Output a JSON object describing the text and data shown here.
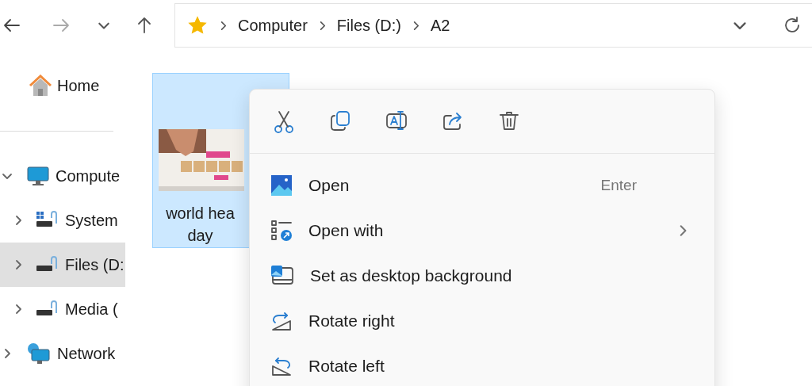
{
  "address_bar": {
    "crumbs": [
      "Computer",
      "Files (D:)",
      "A2"
    ]
  },
  "sidebar": {
    "home": {
      "label": "Home"
    },
    "tree": [
      {
        "label": "Compute",
        "kind": "computer",
        "expanded": true,
        "selected": false,
        "children": [
          {
            "label": "System",
            "kind": "system-drive",
            "expanded": false,
            "selected": false
          },
          {
            "label": "Files (D:",
            "kind": "drive",
            "expanded": false,
            "selected": true
          },
          {
            "label": "Media (",
            "kind": "drive",
            "expanded": false,
            "selected": false
          }
        ]
      },
      {
        "label": "Network",
        "kind": "network",
        "expanded": false,
        "selected": false
      }
    ]
  },
  "files": [
    {
      "kind": "picture",
      "name_lines": [
        "world hea",
        "day"
      ],
      "selected": true
    }
  ],
  "context_menu": {
    "items": [
      {
        "kind": "open",
        "label": "Open",
        "shortcut": "Enter",
        "submenu": false
      },
      {
        "kind": "open-with",
        "label": "Open with",
        "submenu": true
      },
      {
        "kind": "wallpaper",
        "label": "Set as desktop background",
        "submenu": false
      },
      {
        "kind": "rotate-right",
        "label": "Rotate right",
        "submenu": false
      },
      {
        "kind": "rotate-left",
        "label": "Rotate left",
        "submenu": false
      }
    ]
  }
}
